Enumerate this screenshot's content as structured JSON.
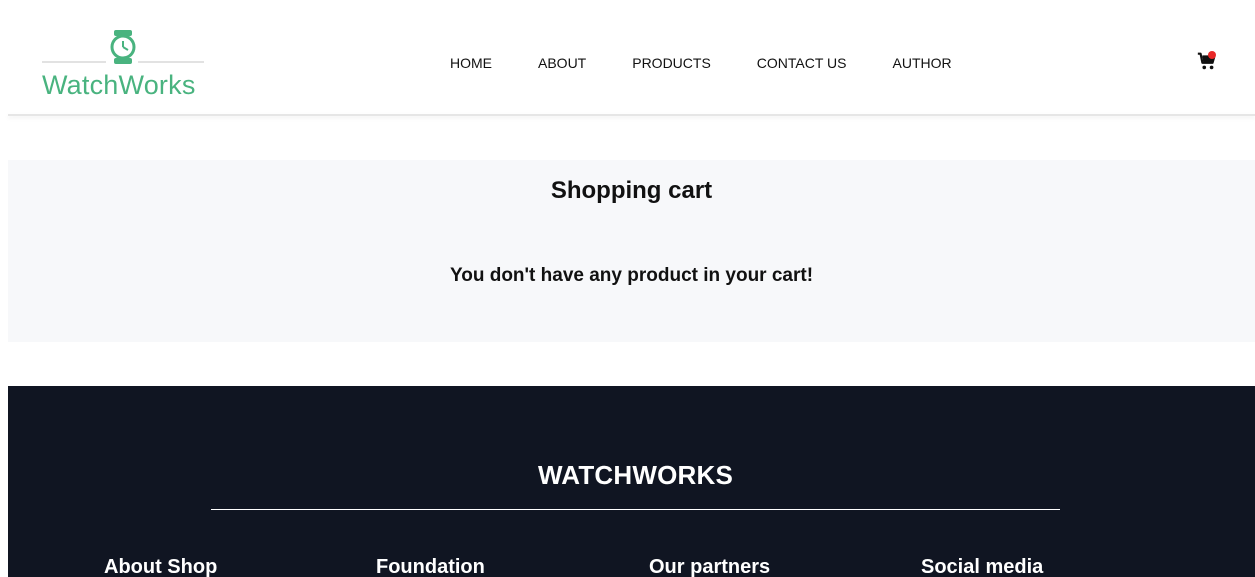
{
  "brand": {
    "logo_text": "WatchWorks",
    "accent_color": "#49b37f"
  },
  "nav": {
    "items": [
      {
        "label": "HOME"
      },
      {
        "label": "ABOUT"
      },
      {
        "label": "PRODUCTS"
      },
      {
        "label": "CONTACT US"
      },
      {
        "label": "AUTHOR"
      }
    ]
  },
  "icons": {
    "logo": "watch-icon",
    "cart": "shopping-cart-icon",
    "badge": "notification-dot-icon"
  },
  "cart_section": {
    "title": "Shopping cart",
    "message": "You don't have any product in your cart!"
  },
  "footer": {
    "brand": "WATCHWORKS",
    "columns": [
      {
        "title": "About Shop"
      },
      {
        "title": "Foundation"
      },
      {
        "title": "Our partners"
      },
      {
        "title": "Social media"
      }
    ],
    "background_color": "#101522"
  }
}
